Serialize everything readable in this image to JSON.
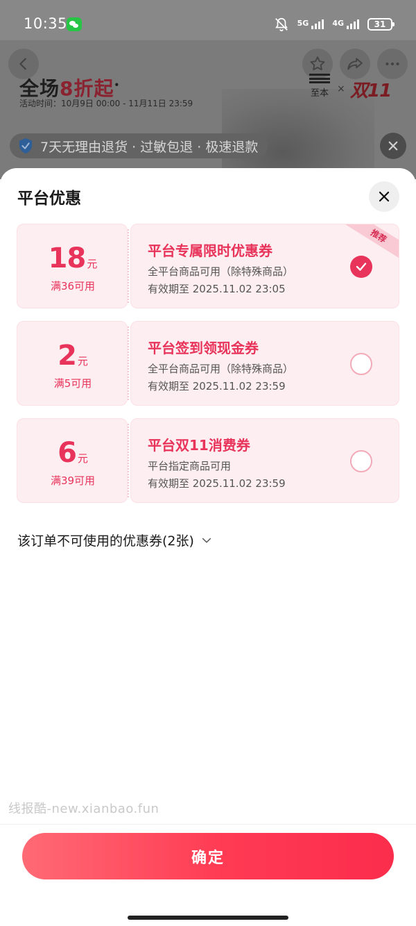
{
  "status_bar": {
    "time": "10:35",
    "net1": "5G",
    "net2": "4G",
    "battery": "31",
    "icons": [
      "wechat-icon",
      "mute-bell-icon",
      "signal-icon",
      "battery-icon"
    ]
  },
  "background_page": {
    "promo_prefix": "全场",
    "promo_accent": "8折起",
    "promo_mark": "•",
    "promo_time": "活动时间：10月9日 00:00 - 11月11日 23:59",
    "brand_name": "至本",
    "brand_x": "×",
    "event_logo": "双11",
    "service_text": "7天无理由退货 · 过敏包退 · 极速退款",
    "icons": [
      "back-arrow-icon",
      "star-icon",
      "share-icon",
      "more-dots-icon",
      "shield-check-icon",
      "close-icon"
    ]
  },
  "sheet": {
    "title": "平台优惠",
    "coupons": [
      {
        "amount": "18",
        "unit": "元",
        "threshold": "满36可用",
        "title": "平台专属限时优惠券",
        "scope": "全平台商品可用（除特殊商品）",
        "expire": "有效期至 2025.11.02 23:05",
        "badge": "推荐",
        "selected": true
      },
      {
        "amount": "2",
        "unit": "元",
        "threshold": "满5可用",
        "title": "平台签到领现金券",
        "scope": "全平台商品可用（除特殊商品）",
        "expire": "有效期至 2025.11.02 23:59",
        "selected": false
      },
      {
        "amount": "6",
        "unit": "元",
        "threshold": "满39可用",
        "title": "平台双11消费券",
        "scope": "平台指定商品可用",
        "expire": "有效期至 2025.11.02 23:59",
        "selected": false
      }
    ],
    "unusable_label": "该订单不可使用的优惠券(2张)",
    "watermark": "线报酷-new.xianbao.fun",
    "confirm_label": "确定"
  },
  "colors": {
    "accent": "#e8335a",
    "coupon_bg": "#fdeef1",
    "button_gradient_start": "#ff6a74",
    "button_gradient_end": "#fb2d4c"
  }
}
